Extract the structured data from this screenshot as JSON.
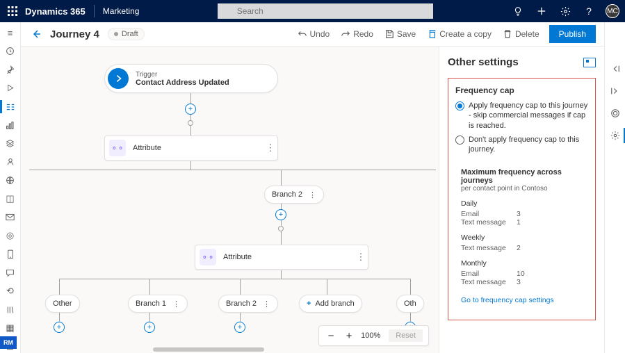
{
  "topbar": {
    "brand": "Dynamics 365",
    "app": "Marketing",
    "search_placeholder": "Search",
    "avatar_initials": "MC"
  },
  "cmdbar": {
    "title": "Journey 4",
    "status": "Draft",
    "undo": "Undo",
    "redo": "Redo",
    "save": "Save",
    "copy": "Create a copy",
    "delete": "Delete",
    "publish": "Publish"
  },
  "canvas": {
    "trigger_heading": "Trigger",
    "trigger_label": "Contact Address Updated",
    "attribute_label": "Attribute",
    "branch2": "Branch 2",
    "other": "Other",
    "branch1": "Branch 1",
    "add_branch": "Add branch",
    "oth": "Oth",
    "zoom": "100%",
    "reset": "Reset"
  },
  "panel": {
    "title": "Other settings",
    "freq_title": "Frequency cap",
    "radio_apply": "Apply frequency cap to this journey - skip commercial messages if cap is reached.",
    "radio_no": "Don't apply frequency cap to this journey.",
    "max_title": "Maximum frequency across journeys",
    "max_sub": "per contact point in Contoso",
    "daily": "Daily",
    "weekly": "Weekly",
    "monthly": "Monthly",
    "email": "Email",
    "text": "Text message",
    "daily_email": "3",
    "daily_text": "1",
    "weekly_text": "2",
    "monthly_email": "10",
    "monthly_text": "3",
    "link": "Go to frequency cap settings"
  },
  "leftrail_badge": "RM"
}
